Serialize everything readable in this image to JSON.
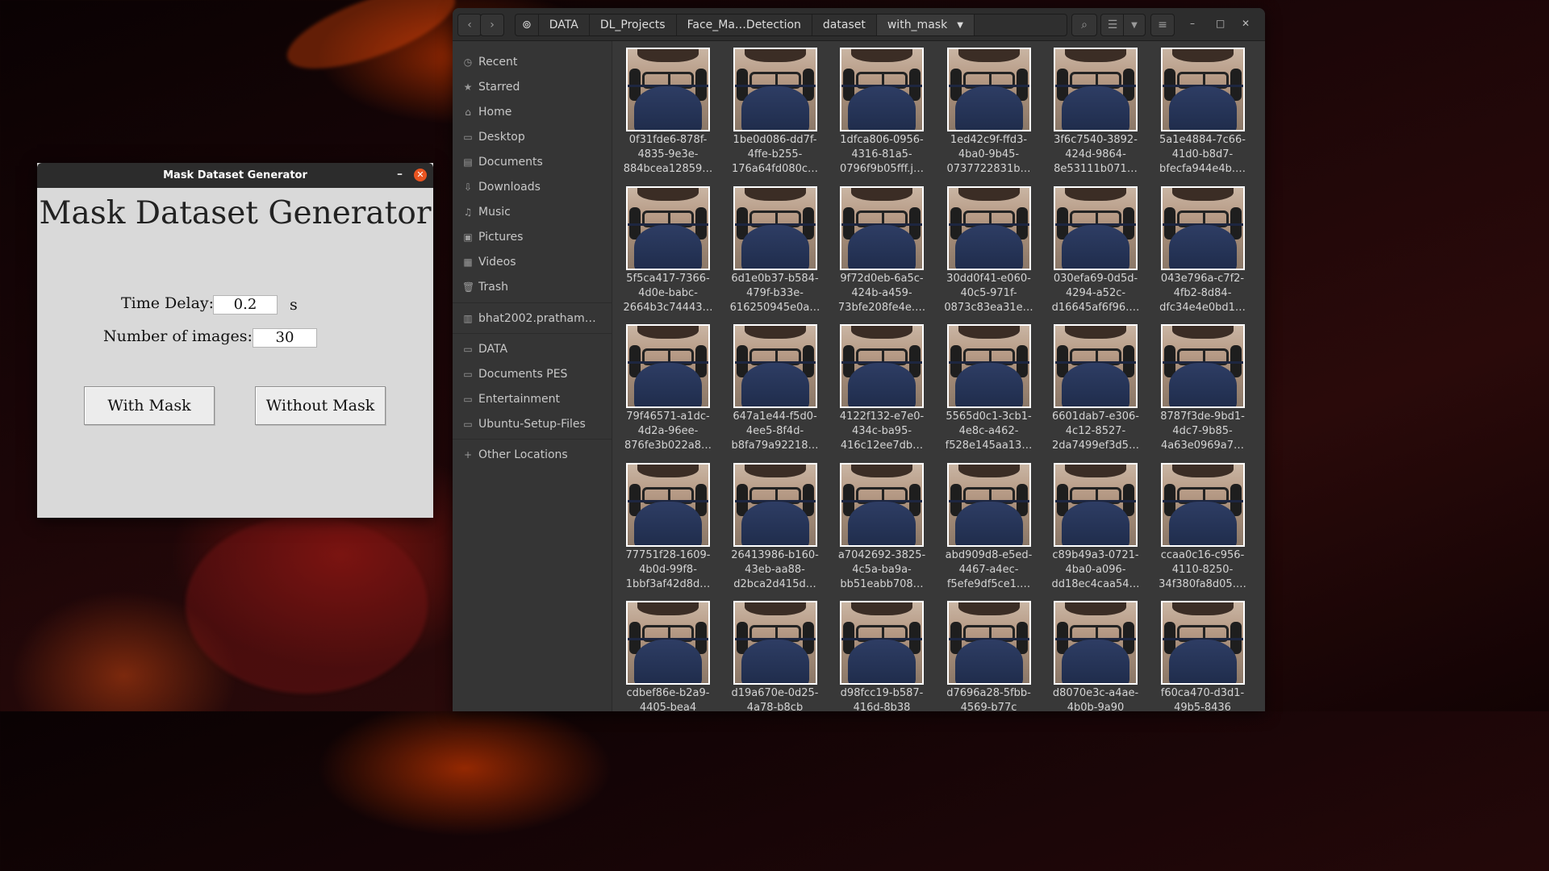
{
  "tk_app": {
    "window_title": "Mask Dataset Generator",
    "heading": "Mask Dataset Generator",
    "time_delay_label": "Time Delay:",
    "time_delay_value": "0.2",
    "time_delay_unit": "s",
    "num_images_label": "Number of images:",
    "num_images_value": "30",
    "with_mask_label": "With Mask",
    "without_mask_label": "Without Mask"
  },
  "file_manager": {
    "breadcrumbs": [
      "DATA",
      "DL_Projects",
      "Face_Ma…Detection",
      "dataset",
      "with_mask"
    ],
    "sidebar": [
      {
        "label": "Recent",
        "icon": "clock-icon"
      },
      {
        "label": "Starred",
        "icon": "star-icon"
      },
      {
        "label": "Home",
        "icon": "home-icon"
      },
      {
        "label": "Desktop",
        "icon": "desktop-icon"
      },
      {
        "label": "Documents",
        "icon": "document-icon"
      },
      {
        "label": "Downloads",
        "icon": "download-icon"
      },
      {
        "label": "Music",
        "icon": "music-icon"
      },
      {
        "label": "Pictures",
        "icon": "picture-icon"
      },
      {
        "label": "Videos",
        "icon": "video-icon"
      },
      {
        "label": "Trash",
        "icon": "trash-icon"
      },
      {
        "label": "bhat2002.pratham…",
        "icon": "network-drive-icon"
      },
      {
        "label": "DATA",
        "icon": "folder-icon"
      },
      {
        "label": "Documents PES",
        "icon": "folder-icon"
      },
      {
        "label": "Entertainment",
        "icon": "folder-icon"
      },
      {
        "label": "Ubuntu-Setup-Files",
        "icon": "folder-icon"
      },
      {
        "label": "Other Locations",
        "icon": "plus-icon"
      }
    ],
    "files": [
      "0f31fde6-878f-\n4835-9e3e-\n884bcea12859…",
      "1be0d086-dd7f-\n4ffe-b255-\n176a64fd080c…",
      "1dfca806-0956-\n4316-81a5-\n0796f9b05fff.j…",
      "1ed42c9f-ffd3-\n4ba0-9b45-\n0737722831b…",
      "3f6c7540-3892-\n424d-9864-\n8e53111b071…",
      "5a1e4884-7c66-\n41d0-b8d7-\nbfecfa944e4b.…",
      "5f5ca417-7366-\n4d0e-babc-\n2664b3c74443…",
      "6d1e0b37-b584-\n479f-b33e-\n616250945e0a…",
      "9f72d0eb-6a5c-\n424b-a459-\n73bfe208fe4e.…",
      "30dd0f41-e060-\n40c5-971f-\n0873c83ea31e…",
      "030efa69-0d5d-\n4294-a52c-\nd16645af6f96.…",
      "043e796a-c7f2-\n4fb2-8d84-\ndfc34e4e0bd1…",
      "79f46571-a1dc-\n4d2a-96ee-\n876fe3b022a8…",
      "647a1e44-f5d0-\n4ee5-8f4d-\nb8fa79a92218…",
      "4122f132-e7e0-\n434c-ba95-\n416c12ee7db…",
      "5565d0c1-3cb1-\n4e8c-a462-\nf528e145aa13…",
      "6601dab7-e306-\n4c12-8527-\n2da7499ef3d5…",
      "8787f3de-9bd1-\n4dc7-9b85-\n4a63e0969a7…",
      "77751f28-1609-\n4b0d-99f8-\n1bbf3af42d8d…",
      "26413986-b160-\n43eb-aa88-\nd2bca2d415d…",
      "a7042692-3825-\n4c5a-ba9a-\nbb51eabb708…",
      "abd909d8-e5ed-\n4467-a4ec-\nf5efe9df5ce1.…",
      "c89b49a3-0721-\n4ba0-a096-\ndd18ec4caa54…",
      "ccaa0c16-c956-\n4110-8250-\n34f380fa8d05.…",
      "cdbef86e-b2a9-\n4405-bea4",
      "d19a670e-0d25-\n4a78-b8cb",
      "d98fcc19-b587-\n416d-8b38",
      "d7696a28-5fbb-\n4569-b77c",
      "d8070e3c-a4ae-\n4b0b-9a90",
      "f60ca470-d3d1-\n49b5-8436"
    ]
  }
}
